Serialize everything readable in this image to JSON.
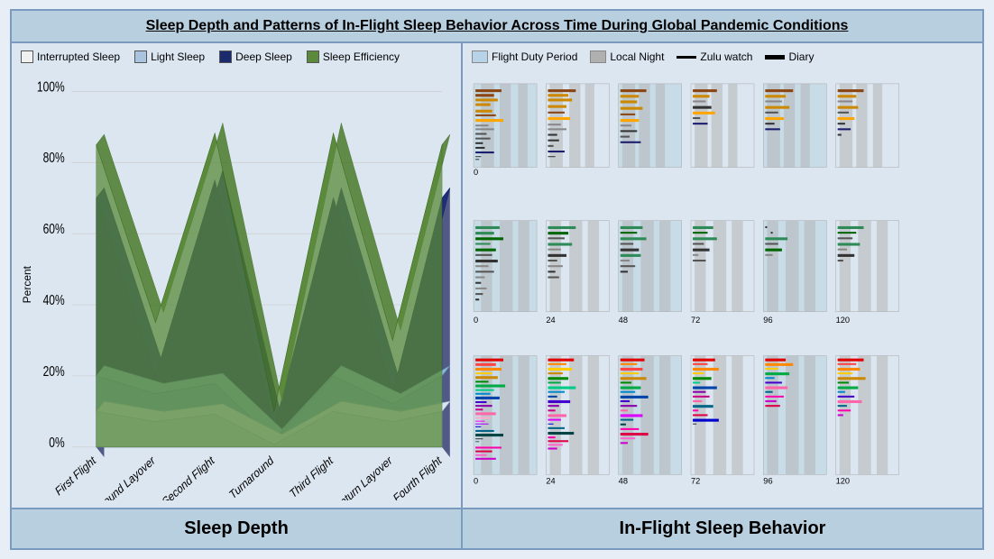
{
  "title": "Sleep Depth and Patterns of In-Flight Sleep Behavior Across Time During Global Pandemic Conditions",
  "left_panel": {
    "legend": [
      {
        "label": "Interrupted Sleep",
        "color": "#f0f0f0",
        "border": "#555"
      },
      {
        "label": "Light Sleep",
        "color": "#aac4e0",
        "border": "#555"
      },
      {
        "label": "Deep Sleep",
        "color": "#1a2a6c",
        "border": "#555"
      },
      {
        "label": "Sleep Efficiency",
        "color": "#5a8a3a",
        "border": "#555"
      }
    ],
    "y_axis_label": "Percent",
    "y_ticks": [
      "100%",
      "80%",
      "60%",
      "40%",
      "20%",
      "0%"
    ],
    "x_ticks": [
      "First Flight",
      "Outbound Layover",
      "Second Flight",
      "Turnaround",
      "Third Flight",
      "Return Layover",
      "Fourth Flight"
    ],
    "bottom_label": "Sleep Depth"
  },
  "right_panel": {
    "legend": [
      {
        "label": "Flight Duty Period",
        "type": "rect",
        "color": "#b8d3e8"
      },
      {
        "label": "Local Night",
        "type": "rect",
        "color": "#b0b0b0"
      },
      {
        "label": "Zulu watch",
        "type": "line",
        "color": "#000"
      },
      {
        "label": "Diary",
        "type": "line_thick",
        "color": "#111"
      }
    ],
    "x_ticks": [
      "0",
      "24",
      "48",
      "72",
      "96",
      "120"
    ],
    "bottom_label": "In-Flight Sleep Behavior"
  }
}
